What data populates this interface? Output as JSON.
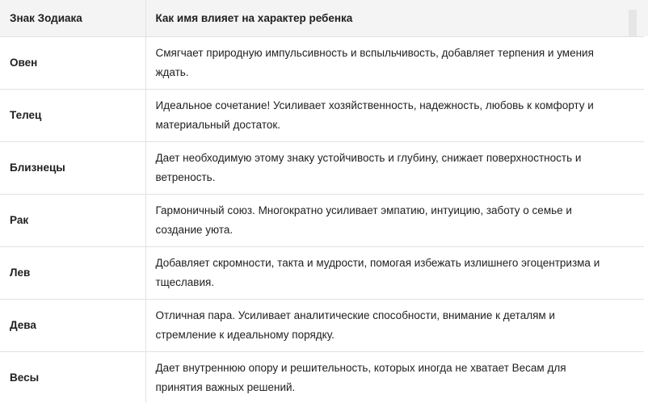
{
  "table": {
    "headers": [
      "Знак Зодиака",
      "Как имя влияет на характер ребенка"
    ],
    "rows": [
      {
        "sign": "Овен",
        "text": "Смягчает природную импульсивность и вспыльчивость, добавляет терпения и умения ждать."
      },
      {
        "sign": "Телец",
        "text": "Идеальное сочетание! Усиливает хозяйственность, надежность, любовь к комфорту и материальный достаток."
      },
      {
        "sign": "Близнецы",
        "text": "Дает необходимую этому знаку устойчивость и глубину, снижает поверхностность и ветреность."
      },
      {
        "sign": "Рак",
        "text": "Гармоничный союз. Многократно усиливает эмпатию, интуицию, заботу о семье и создание уюта."
      },
      {
        "sign": "Лев",
        "text": "Добавляет скромности, такта и мудрости, помогая избежать излишнего эгоцентризма и тщеславия."
      },
      {
        "sign": "Дева",
        "text": "Отличная пара. Усиливает аналитические способности, внимание к деталям и стремление к идеальному порядку."
      },
      {
        "sign": "Весы",
        "text": "Дает внутреннюю опору и решительность, которых иногда не хватает Весам для принятия важных решений."
      }
    ]
  }
}
